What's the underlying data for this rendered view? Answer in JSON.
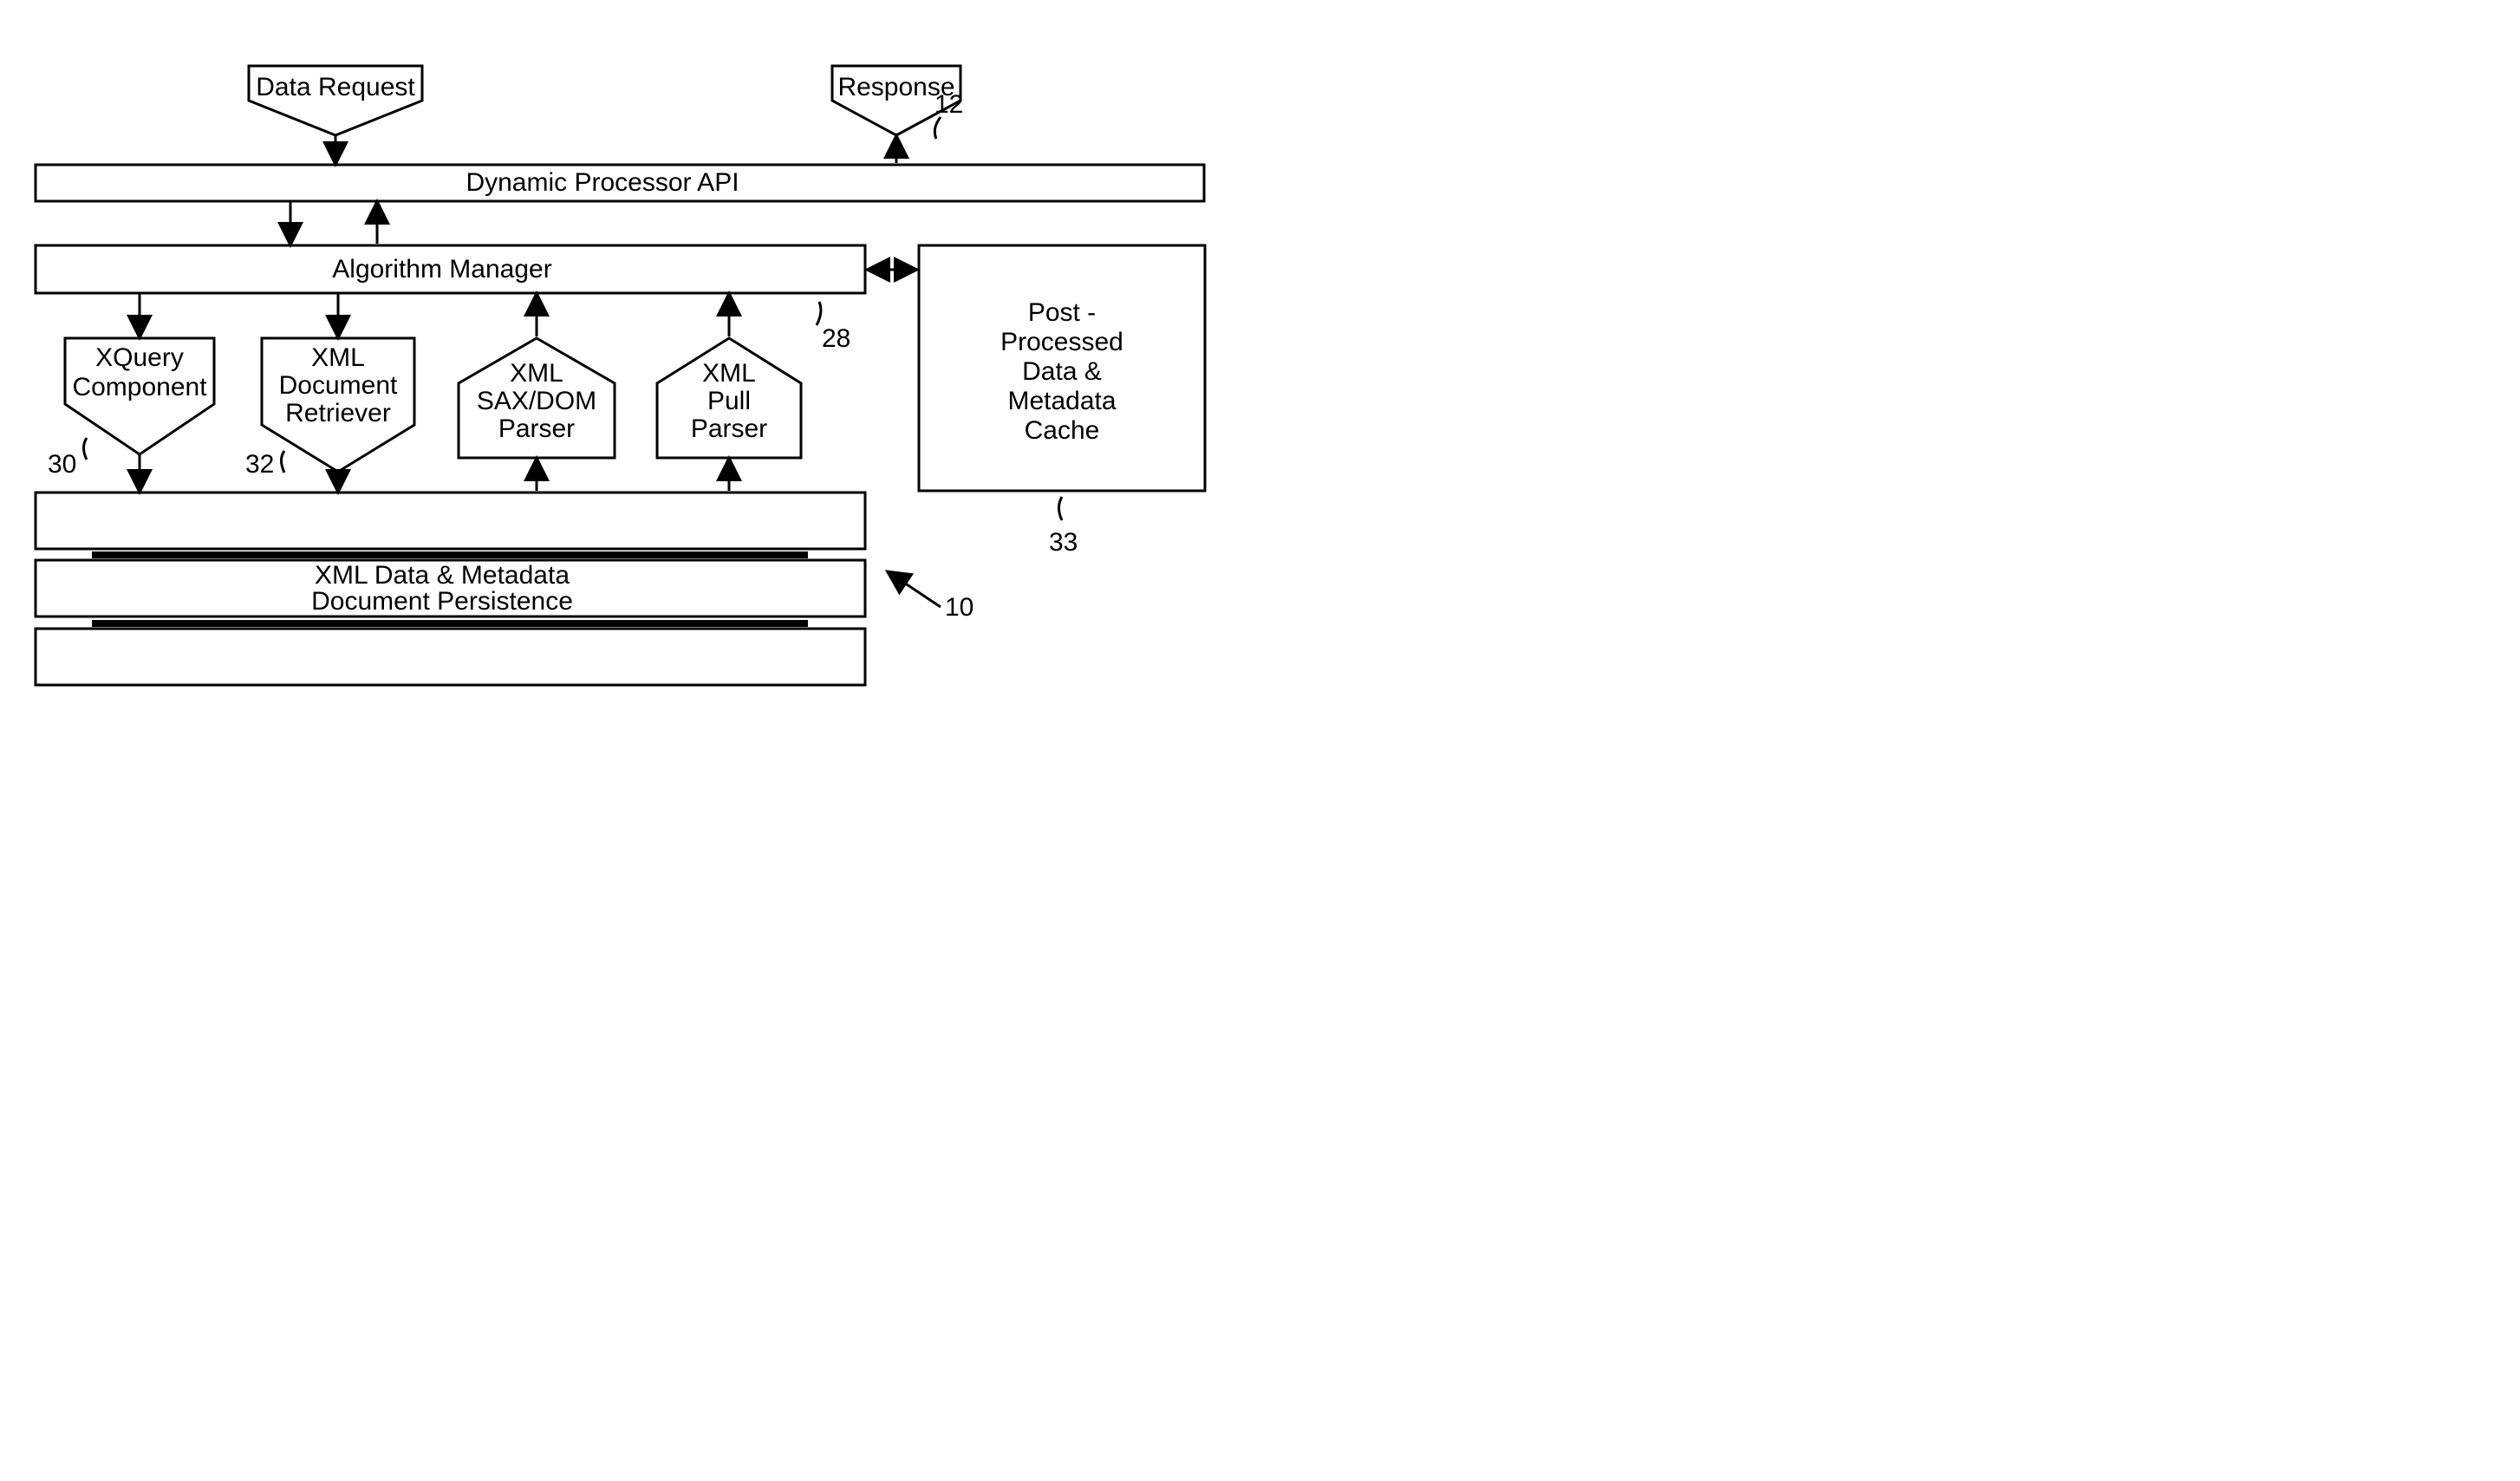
{
  "nodes": {
    "data_request": "Data Request",
    "response": "Response",
    "api": "Dynamic Processor API",
    "algo_mgr": "Algorithm Manager",
    "xquery": {
      "l1": "XQuery",
      "l2": "Component"
    },
    "xml_doc_ret": {
      "l1": "XML",
      "l2": "Document",
      "l3": "Retriever"
    },
    "sax_dom": {
      "l1": "XML",
      "l2": "SAX/DOM",
      "l3": "Parser"
    },
    "pull": {
      "l1": "XML",
      "l2": "Pull",
      "l3": "Parser"
    },
    "cache": {
      "l1": "Post -",
      "l2": "Processed",
      "l3": "Data &",
      "l4": "Metadata",
      "l5": "Cache"
    },
    "persistence": {
      "l1": "XML Data & Metadata",
      "l2": "Document Persistence"
    }
  },
  "refs": {
    "r12": "12",
    "r28": "28",
    "r30": "30",
    "r32": "32",
    "r33": "33",
    "r10": "10"
  }
}
